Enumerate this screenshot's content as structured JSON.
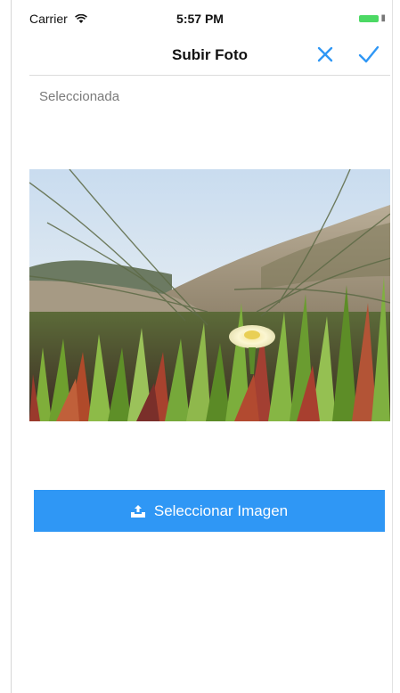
{
  "status_bar": {
    "carrier": "Carrier",
    "time": "5:57 PM",
    "battery_color": "#4cd964"
  },
  "nav": {
    "title": "Subir Foto",
    "cancel_icon": "close-icon",
    "confirm_icon": "checkmark-icon",
    "accent_color": "#2f97f5"
  },
  "content": {
    "section_label": "Seleccionada",
    "photo_subject": "flower-in-dune-grass"
  },
  "actions": {
    "select_image_label": "Seleccionar Imagen",
    "select_image_icon": "upload-icon",
    "button_color": "#2f97f5"
  }
}
